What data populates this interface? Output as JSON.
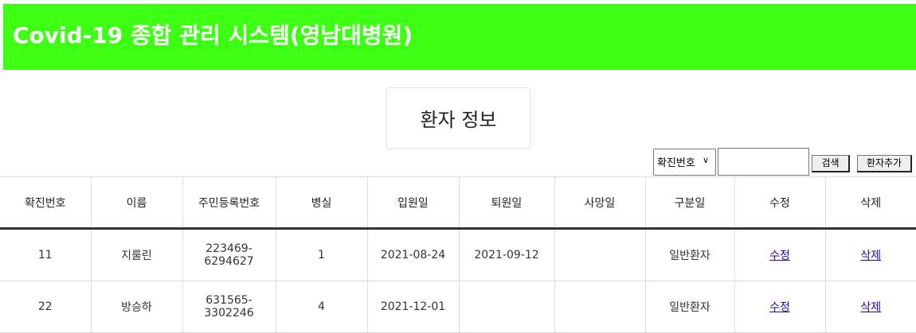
{
  "header": {
    "title": "Covid-19 종합 관리 시스템(영남대병원)"
  },
  "page": {
    "title": "환자 정보"
  },
  "search": {
    "selected_option": "확진번호",
    "input_value": "",
    "search_label": "검색",
    "add_label": "환자추가"
  },
  "colors": {
    "header_bg": "#3cff14",
    "link": "#1a0dab"
  },
  "table": {
    "columns": [
      "확진번호",
      "이름",
      "주민등록번호",
      "병실",
      "입원일",
      "퇴원일",
      "사망일",
      "구분일",
      "수정",
      "삭제"
    ],
    "rows": [
      {
        "id": "11",
        "name": "지룰린",
        "rrn": "223469-6294627",
        "room": "1",
        "admitted": "2021-08-24",
        "discharged": "2021-09-12",
        "deceased": "",
        "category": "일반환자",
        "edit": "수정",
        "delete": "삭제"
      },
      {
        "id": "22",
        "name": "방승하",
        "rrn": "631565-3302246",
        "room": "4",
        "admitted": "2021-12-01",
        "discharged": "",
        "deceased": "",
        "category": "일반환자",
        "edit": "수정",
        "delete": "삭제"
      }
    ]
  }
}
